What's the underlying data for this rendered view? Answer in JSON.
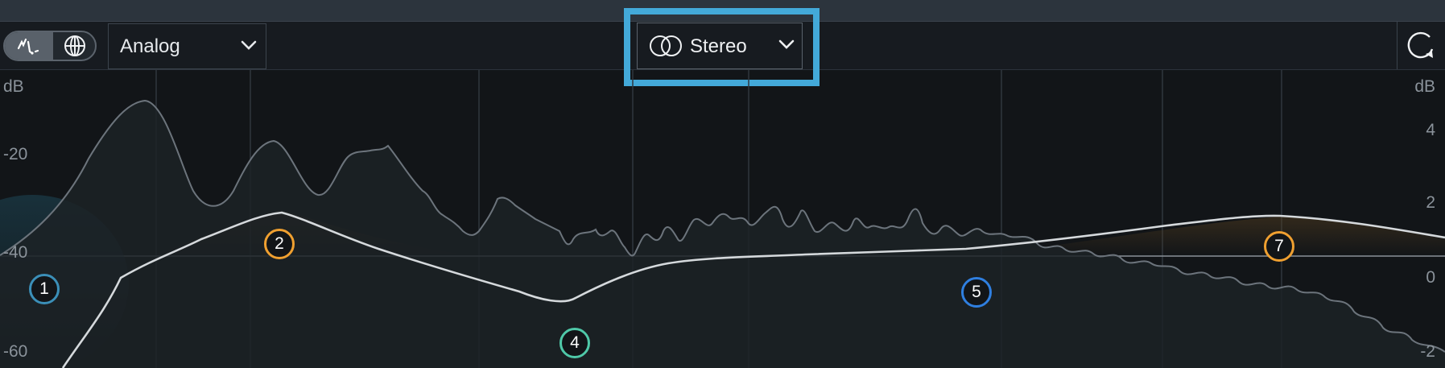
{
  "toolbar": {
    "view_toggle": {
      "curve_icon": "curve-view-icon",
      "globe_icon": "global-view-icon"
    },
    "mode_select": {
      "value": "Analog",
      "chevron_icon": "chevron-down-icon"
    },
    "channel_select": {
      "value": "Stereo",
      "icon": "stereo-rings-icon",
      "chevron_icon": "chevron-down-icon",
      "highlight_color": "#43a9d9"
    },
    "reset_icon": "refresh-icon"
  },
  "axes": {
    "left_unit": "dB",
    "right_unit": "dB",
    "left_ticks": [
      "-20",
      "-40",
      "-60"
    ],
    "right_ticks": [
      "4",
      "2",
      "0",
      "-2"
    ]
  },
  "eq_nodes": [
    {
      "label": "1",
      "color": "#3b8fb8"
    },
    {
      "label": "2",
      "color": "#f0a030"
    },
    {
      "label": "4",
      "color": "#4fc8a8"
    },
    {
      "label": "5",
      "color": "#2f7fe0"
    },
    {
      "label": "7",
      "color": "#f0a030"
    }
  ],
  "colors": {
    "background": "#121518",
    "spectrum_line": "#6c747c",
    "eq_curve": "#d5d9dc",
    "accent_highlight": "#43a9d9"
  }
}
